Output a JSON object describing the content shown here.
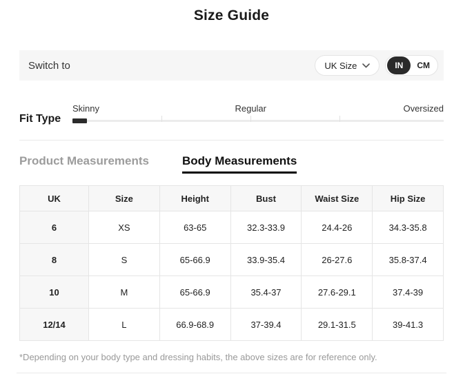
{
  "page": {
    "title": "Size Guide"
  },
  "switch_bar": {
    "label": "Switch to",
    "region_selector": {
      "value": "UK Size",
      "chevron_icon": "chevron-down"
    },
    "unit_toggle": {
      "options": [
        "IN",
        "CM"
      ],
      "selected": "IN"
    }
  },
  "fit_type": {
    "label": "Fit Type",
    "options": [
      "Skinny",
      "Regular",
      "Oversized"
    ],
    "selected": "Skinny"
  },
  "tabs": [
    {
      "label": "Product Measurements",
      "active": false
    },
    {
      "label": "Body Measurements",
      "active": true
    }
  ],
  "table": {
    "headers": [
      "UK",
      "Size",
      "Height",
      "Bust",
      "Waist Size",
      "Hip Size"
    ],
    "rows": [
      [
        "6",
        "XS",
        "63-65",
        "32.3-33.9",
        "24.4-26",
        "34.3-35.8"
      ],
      [
        "8",
        "S",
        "65-66.9",
        "33.9-35.4",
        "26-27.6",
        "35.8-37.4"
      ],
      [
        "10",
        "M",
        "65-66.9",
        "35.4-37",
        "27.6-29.1",
        "37.4-39"
      ],
      [
        "12/14",
        "L",
        "66.9-68.9",
        "37-39.4",
        "29.1-31.5",
        "39-41.3"
      ]
    ]
  },
  "footnote": "*Depending on your body type and dressing habits, the above sizes are for reference only.",
  "colors": {
    "toggle_active_bg": "#2a2a2a",
    "bar_bg": "#f6f6f6",
    "table_header_bg": "#f7f7f7",
    "border": "#e5e5e5",
    "muted_text": "#999999",
    "inactive_tab": "#9c9c9c",
    "slider_handle": "#2b2b2b"
  }
}
